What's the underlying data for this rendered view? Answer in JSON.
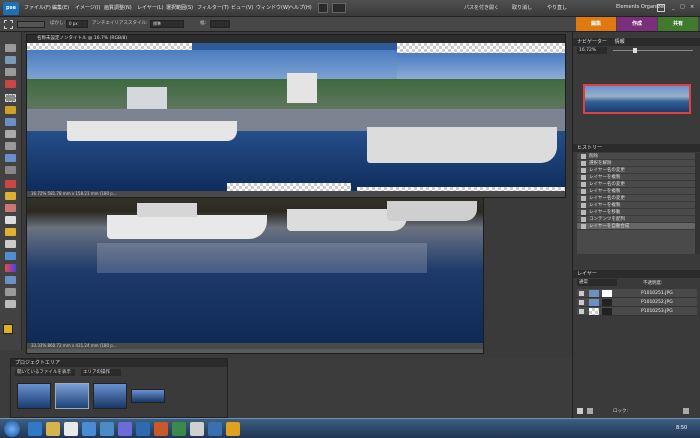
{
  "app": {
    "logo_text": "pse"
  },
  "menu": [
    "ファイル(F)",
    "編集(E)",
    "イメージ(I)",
    "画質調整(N)",
    "レイヤー(L)",
    "選択範囲(S)",
    "フィルター(T)",
    "ビュー(V)",
    "ウィンドウ(W)",
    "ヘルプ(H)"
  ],
  "titlebar_right": {
    "panorama": "パスを付き開く",
    "undo": "取り消し",
    "redo": "やり直し",
    "organizer": "Elements Organizer"
  },
  "options": {
    "feather_label": "ぼかし:",
    "feather_value": "0 px",
    "antialias": "アンチエイリアス",
    "style_label": "スタイル:",
    "style_value": "標準",
    "width_label": "幅:"
  },
  "mode_tabs": {
    "edit": "編集",
    "create": "作成",
    "share": "共有",
    "edit_color": "#e07a10",
    "create_color": "#7a2f7a",
    "share_color": "#3f7a2f"
  },
  "doc1": {
    "title": "名称未設定ノンタイトル @ 16.7% (RGB/8)",
    "status": "16.72%     581.78 mm x 158.21 mm (180 p..."
  },
  "doc2": {
    "status": "33.33%     860.72 mm x 431.24 mm (180 p..."
  },
  "navigator": {
    "title": "ナビゲーター",
    "tab2": "情報",
    "zoom": "16.72%"
  },
  "history": {
    "title": "ヒストリー",
    "items": [
      "削除",
      "選択を解除",
      "レイヤー名の変更",
      "レイヤーを複製",
      "レイヤー名の変更",
      "レイヤーを複製",
      "レイヤー名の変更",
      "レイヤーを複製",
      "レイヤーを移動",
      "コンテンツを配列",
      "レイヤーを自動合成"
    ]
  },
  "layers": {
    "title": "レイヤー",
    "blend": "通常",
    "opacity_label": "不透明度:",
    "rows": [
      {
        "name": "P1010251.JPG"
      },
      {
        "name": "P1010252.JPG"
      },
      {
        "name": "P1010253.JPG"
      }
    ],
    "lock_label": "ロック:"
  },
  "project_bin": {
    "title": "プロジェクトエリア",
    "dropdown": "開いているファイルを表示",
    "button": "エリアの操作"
  },
  "clock": "8:50"
}
